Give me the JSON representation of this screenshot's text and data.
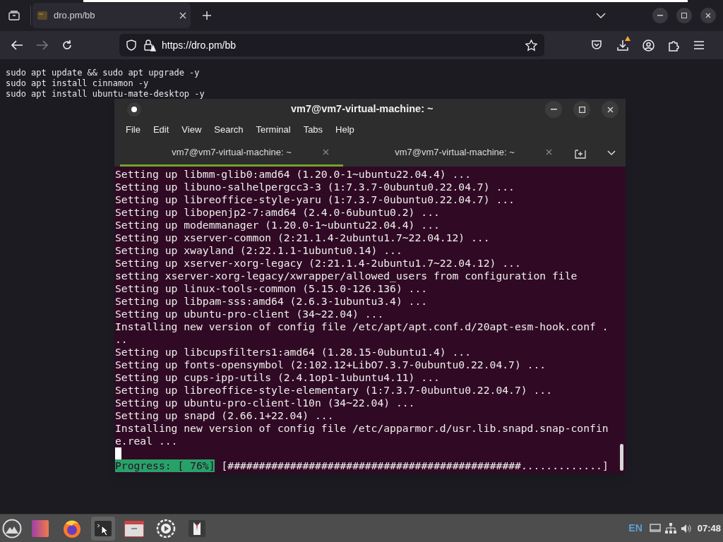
{
  "browser": {
    "tabs": [
      {
        "title": "dro.pm/bb",
        "selected": true
      }
    ],
    "url": "https://dro.pm/bb",
    "downloads_alert": true,
    "page_lines": [
      "sudo apt update && sudo apt upgrade -y",
      "sudo apt install cinnamon -y",
      "sudo apt install ubuntu-mate-desktop -y"
    ]
  },
  "terminal": {
    "title": "vm7@vm7-virtual-machine: ~",
    "menu": [
      "File",
      "Edit",
      "View",
      "Search",
      "Terminal",
      "Tabs",
      "Help"
    ],
    "tabs": [
      {
        "title": "vm7@vm7-virtual-machine: ~",
        "selected": true
      },
      {
        "title": "vm7@vm7-virtual-machine: ~",
        "selected": false
      }
    ],
    "lines": [
      "Setting up libmm-glib0:amd64 (1.20.0-1~ubuntu22.04.4) ...",
      "Setting up libuno-salhelpergcc3-3 (1:7.3.7-0ubuntu0.22.04.7) ...",
      "Setting up libreoffice-style-yaru (1:7.3.7-0ubuntu0.22.04.7) ...",
      "Setting up libopenjp2-7:amd64 (2.4.0-6ubuntu0.2) ...",
      "Setting up modemmanager (1.20.0-1~ubuntu22.04.4) ...",
      "Setting up xserver-common (2:21.1.4-2ubuntu1.7~22.04.12) ...",
      "Setting up xwayland (2:22.1.1-1ubuntu0.14) ...",
      "Setting up xserver-xorg-legacy (2:21.1.4-2ubuntu1.7~22.04.12) ...",
      "setting xserver-xorg-legacy/xwrapper/allowed_users from configuration file",
      "Setting up linux-tools-common (5.15.0-126.136) ...",
      "Setting up libpam-sss:amd64 (2.6.3-1ubuntu3.4) ...",
      "Setting up ubuntu-pro-client (34~22.04) ...",
      "Installing new version of config file /etc/apt/apt.conf.d/20apt-esm-hook.conf .",
      "..",
      "Setting up libcupsfilters1:amd64 (1.28.15-0ubuntu1.4) ...",
      "Setting up fonts-opensymbol (2:102.12+LibO7.3.7-0ubuntu0.22.04.7) ...",
      "Setting up cups-ipp-utils (2.4.1op1-1ubuntu4.11) ...",
      "Setting up libreoffice-style-elementary (1:7.3.7-0ubuntu0.22.04.7) ...",
      "Setting up ubuntu-pro-client-l10n (34~22.04) ...",
      "Setting up snapd (2.66.1+22.04) ...",
      "Installing new version of config file /etc/apparmor.d/usr.lib.snapd.snap-confin",
      "e.real ..."
    ],
    "progress_label": "Progress: [ 76%]",
    "progress_bar": "[###############################################.............]"
  },
  "taskbar": {
    "keyboard_layout": "EN",
    "clock": "07:48"
  }
}
